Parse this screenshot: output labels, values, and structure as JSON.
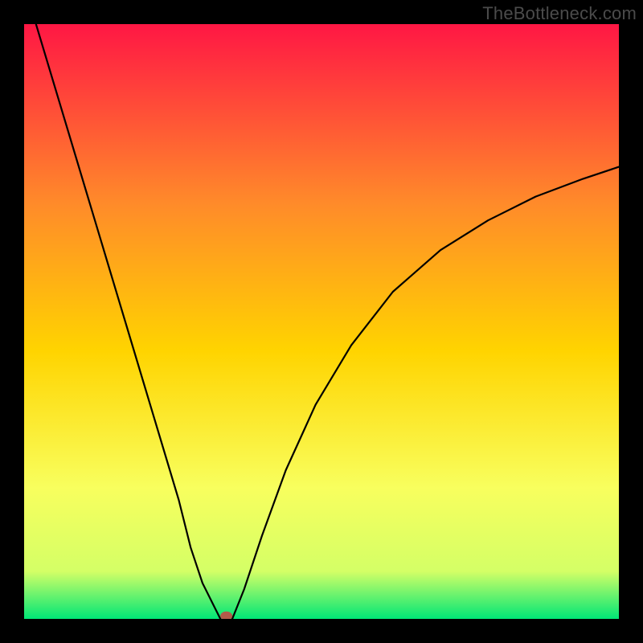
{
  "watermark": "TheBottleneck.com",
  "colors": {
    "frame": "#000000",
    "gradient_top": "#ff1744",
    "gradient_upper_mid": "#ff8a2a",
    "gradient_mid": "#ffd400",
    "gradient_lower_mid": "#f8ff5e",
    "gradient_near_bottom": "#d4ff66",
    "gradient_bottom": "#00e676",
    "curve": "#000000",
    "dot": "#b35b4a"
  },
  "chart_data": {
    "type": "line",
    "title": "",
    "xlabel": "",
    "ylabel": "",
    "xlim": [
      0,
      100
    ],
    "ylim": [
      0,
      100
    ],
    "series": [
      {
        "name": "left-branch",
        "x": [
          2,
          5,
          8,
          11,
          14,
          17,
          20,
          23,
          26,
          28,
          30,
          32,
          33
        ],
        "values": [
          100,
          90,
          80,
          70,
          60,
          50,
          40,
          30,
          20,
          12,
          6,
          2,
          0
        ]
      },
      {
        "name": "right-branch",
        "x": [
          35,
          37,
          40,
          44,
          49,
          55,
          62,
          70,
          78,
          86,
          94,
          100
        ],
        "values": [
          0,
          5,
          14,
          25,
          36,
          46,
          55,
          62,
          67,
          71,
          74,
          76
        ]
      }
    ],
    "marker": {
      "x": 34,
      "y": 0.5,
      "name": "optimal-point"
    },
    "legend": false,
    "grid": false
  }
}
